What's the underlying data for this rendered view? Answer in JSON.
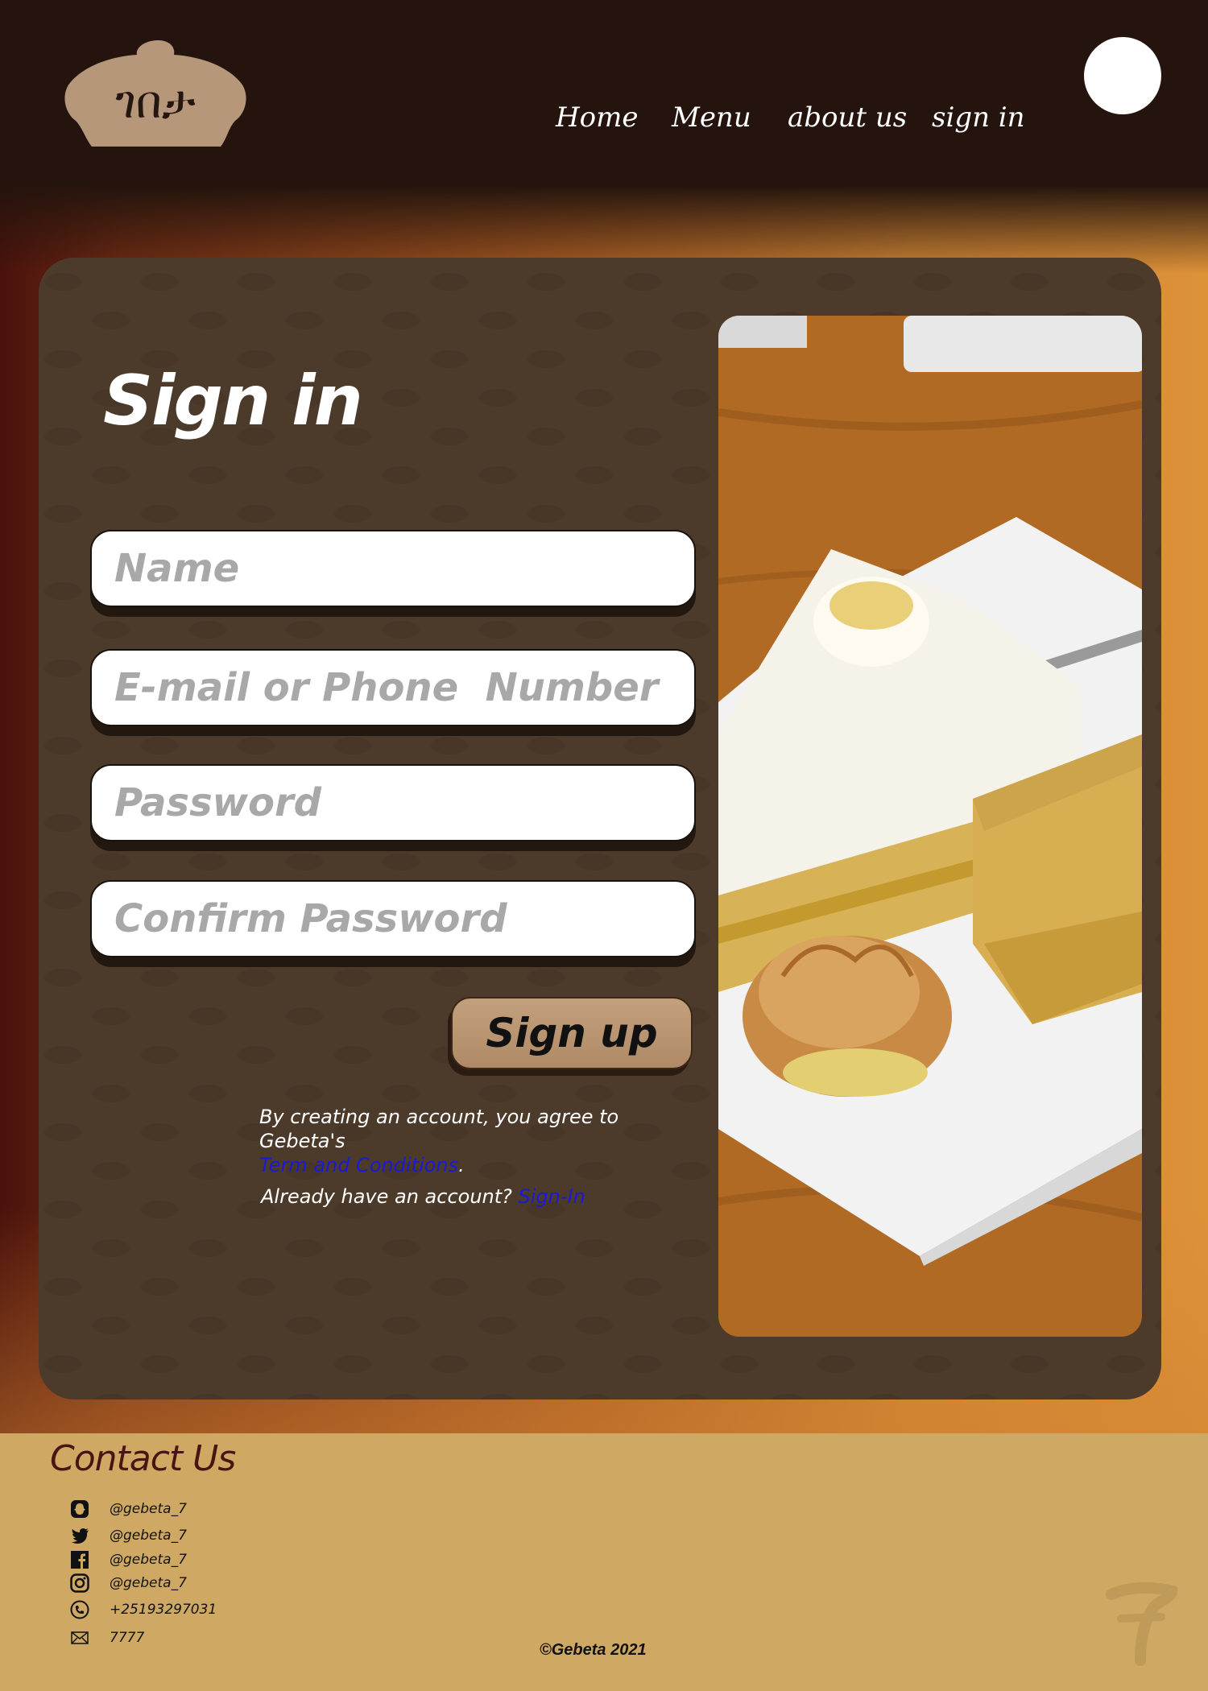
{
  "brand": {
    "logo_text": "ገበታ",
    "icon": "logo-icon"
  },
  "nav": {
    "home": "Home",
    "menu": "Menu",
    "about": "about us",
    "signin": "sign in"
  },
  "profile": {
    "icon": "profile-avatar-icon"
  },
  "form": {
    "title": "Sign in",
    "name_placeholder": "Name",
    "email_placeholder": "E-mail or Phone  Number",
    "password_placeholder": "Password",
    "confirm_placeholder": "Confirm Password",
    "submit_label": "Sign up",
    "agree_text": "By creating an account, you agree to Gebeta's",
    "terms_link": "Term and Conditions",
    "agree_period": ".",
    "already_text": "Already have an account?",
    "signin_link": "Sign-In"
  },
  "photo": {
    "icon": "dessert-photo"
  },
  "footer": {
    "title": "Contact Us",
    "contacts": [
      {
        "icon": "snapchat-icon",
        "text": "@gebeta_7"
      },
      {
        "icon": "twitter-icon",
        "text": "@gebeta_7"
      },
      {
        "icon": "facebook-icon",
        "text": "@gebeta_7"
      },
      {
        "icon": "instagram-icon",
        "text": "@gebeta_7"
      },
      {
        "icon": "phone-icon",
        "text": "+25193297031"
      },
      {
        "icon": "mail-icon",
        "text": "7777"
      }
    ],
    "copyright": "©Gebeta 2021",
    "watermark_icon": "seven-watermark-icon"
  },
  "colors": {
    "header_bg": "#24140d",
    "card_bg": "#4c3a2b",
    "button_bg": "#b99470",
    "link": "#1a1ad6",
    "footer_bg": "#cfa964",
    "contact_title": "#4a1510"
  }
}
